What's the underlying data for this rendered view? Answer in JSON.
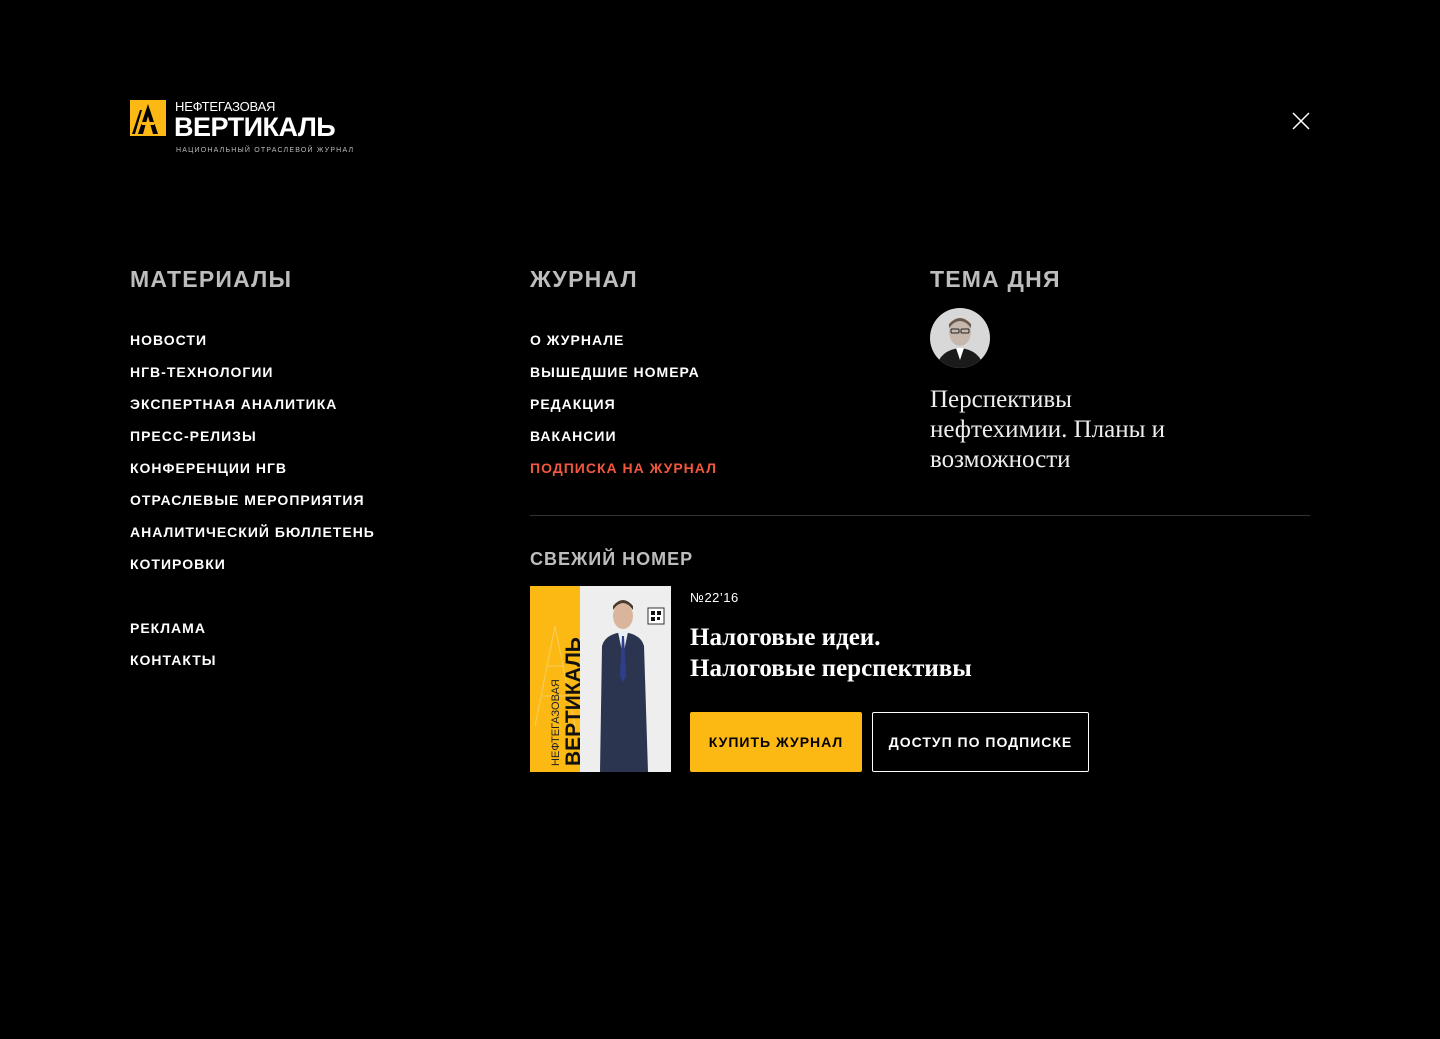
{
  "logo": {
    "top": "НЕФТЕГАЗОВАЯ",
    "main": "ВЕРТИКАЛЬ",
    "sub": "НАЦИОНАЛЬНЫЙ ОТРАСЛЕВОЙ ЖУРНАЛ",
    "icon": "logo-mark-icon",
    "brand_color": "#fdb913"
  },
  "close": {
    "icon": "close-icon"
  },
  "materials": {
    "title": "МАТЕРИАЛЫ",
    "items": [
      "НОВОСТИ",
      "НГВ-ТЕХНОЛОГИИ",
      "ЭКСПЕРТНАЯ АНАЛИТИКА",
      "ПРЕСС-РЕЛИЗЫ",
      "КОНФЕРЕНЦИИ НГВ",
      "ОТРАСЛЕВЫЕ МЕРОПРИЯТИЯ",
      "АНАЛИТИЧЕСКИЙ БЮЛЛЕТЕНЬ",
      "КОТИРОВКИ"
    ],
    "extra_items": [
      "РЕКЛАМА",
      "КОНТАКТЫ"
    ]
  },
  "journal": {
    "title": "ЖУРНАЛ",
    "items": [
      "О ЖУРНАЛЕ",
      "ВЫШЕДШИЕ НОМЕРА",
      "РЕДАКЦИЯ",
      "ВАКАНСИИ",
      "ПОДПИСКА НА ЖУРНАЛ"
    ],
    "accent_color": "#f2583e"
  },
  "topic": {
    "title": "ТЕМА ДНЯ",
    "text": "Перспективы нефтехимии. Планы и возможности"
  },
  "fresh_issue": {
    "title": "СВЕЖИЙ НОМЕР",
    "number": "№22’16",
    "headline_1": "Налоговые идеи.",
    "headline_2": "Налоговые перспективы",
    "buy_label": "КУПИТЬ ЖУРНАЛ",
    "subscribe_label": "ДОСТУП ПО ПОДПИСКЕ",
    "cover": {
      "top_label": "НЕФТЕГАЗОВАЯ",
      "main_label": "ВЕРТИКАЛЬ"
    }
  }
}
